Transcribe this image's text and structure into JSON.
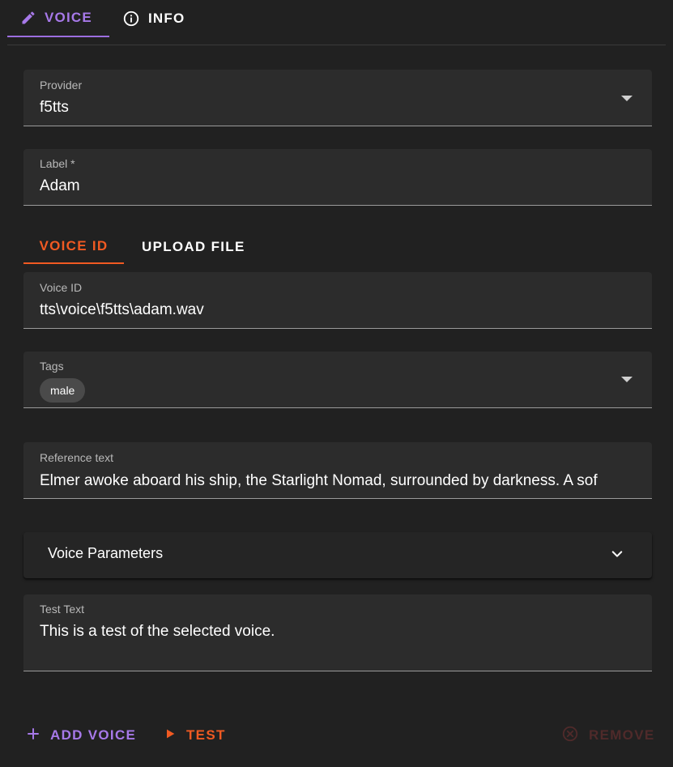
{
  "top_tabs": [
    {
      "label": "VOICE",
      "icon": "pencil-icon",
      "active": true
    },
    {
      "label": "INFO",
      "icon": "info-circle-icon",
      "active": false
    }
  ],
  "provider": {
    "label": "Provider",
    "value": "f5tts"
  },
  "label_field": {
    "label": "Label *",
    "value": "Adam"
  },
  "inner_tabs": [
    {
      "label": "VOICE ID",
      "active": true
    },
    {
      "label": "UPLOAD FILE",
      "active": false
    }
  ],
  "voice_id": {
    "label": "Voice ID",
    "value": "tts\\voice\\f5tts\\adam.wav"
  },
  "tags": {
    "label": "Tags",
    "chips": [
      "male"
    ]
  },
  "reference_text": {
    "label": "Reference text",
    "value": "Elmer awoke aboard his ship, the Starlight Nomad, surrounded by darkness. A sof"
  },
  "voice_parameters": {
    "title": "Voice Parameters",
    "expanded": false
  },
  "test_text": {
    "label": "Test Text",
    "value": "This is a test of the selected voice."
  },
  "buttons": {
    "add_voice": "ADD VOICE",
    "test": "TEST",
    "remove": "REMOVE"
  },
  "colors": {
    "accent_purple": "#a779e9",
    "accent_orange": "#f15a22",
    "background": "#212121",
    "field_bg": "#2c2c2c",
    "remove_disabled": "#4f2a2a"
  }
}
